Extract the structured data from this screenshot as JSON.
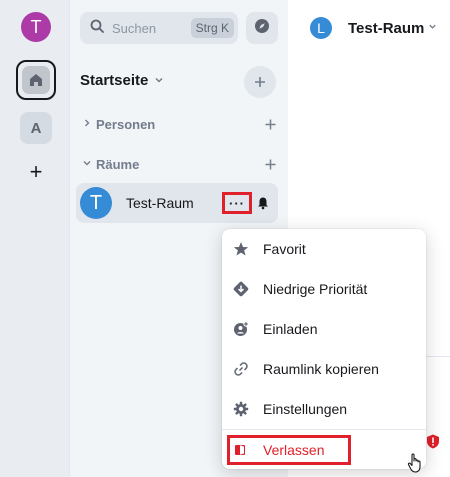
{
  "rail": {
    "user_initial": "T",
    "space_initial": "A",
    "add_label": "+"
  },
  "panel": {
    "search_placeholder": "Suchen",
    "search_shortcut": "Strg K",
    "home_title": "Startseite",
    "sections": [
      {
        "label": "Personen"
      },
      {
        "label": "Räume"
      }
    ],
    "room": {
      "initial": "T",
      "name": "Test-Raum",
      "more_label": "···"
    }
  },
  "main": {
    "room_initial": "L",
    "room_title": "Test-Raum"
  },
  "menu": {
    "items": [
      {
        "label": "Favorit",
        "icon": "star-icon"
      },
      {
        "label": "Niedrige Priorität",
        "icon": "low-priority-icon"
      },
      {
        "label": "Einladen",
        "icon": "invite-icon"
      },
      {
        "label": "Raumlink kopieren",
        "icon": "link-icon"
      },
      {
        "label": "Einstellungen",
        "icon": "settings-icon"
      },
      {
        "label": "Verlassen",
        "icon": "leave-icon"
      }
    ]
  },
  "colors": {
    "accent_red": "#e0202a",
    "avatar_purple": "#ac3ba8",
    "avatar_blue": "#368bd6"
  }
}
